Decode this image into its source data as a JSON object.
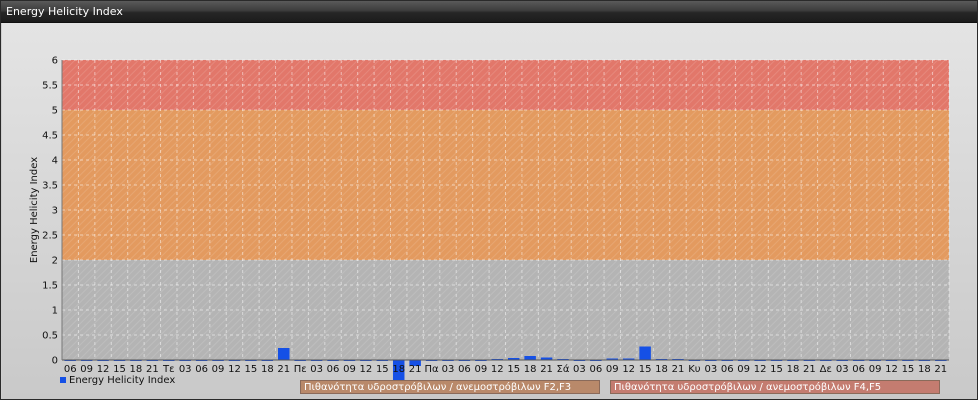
{
  "window": {
    "title": "Energy Helicity Index"
  },
  "chart_data": {
    "type": "bar",
    "title": "",
    "xlabel": "",
    "ylabel": "Energy Helicity Index",
    "ylim": [
      0,
      6
    ],
    "yticks": [
      "0",
      "0.5",
      "1",
      "1.5",
      "2",
      "2.5",
      "3",
      "3.5",
      "4",
      "4.5",
      "5",
      "5.5",
      "6"
    ],
    "grid": true,
    "categories": [
      "06",
      "09",
      "12",
      "15",
      "18",
      "21",
      "Τε",
      "03",
      "06",
      "09",
      "12",
      "15",
      "18",
      "21",
      "Πε",
      "03",
      "06",
      "09",
      "12",
      "15",
      "18",
      "21",
      "Πα",
      "03",
      "06",
      "09",
      "12",
      "15",
      "18",
      "21",
      "Σά",
      "03",
      "06",
      "09",
      "12",
      "15",
      "18",
      "21",
      "Κυ",
      "03",
      "06",
      "09",
      "12",
      "15",
      "18",
      "21",
      "Δε",
      "03",
      "06",
      "09",
      "12",
      "15",
      "18",
      "21"
    ],
    "series": [
      {
        "name": "Energy Helicity Index",
        "color": "#1550e6",
        "values": [
          0.01,
          0.01,
          0.01,
          0.01,
          0.01,
          0.01,
          0.01,
          0.01,
          0.01,
          0.01,
          0.01,
          0.01,
          0.01,
          0.24,
          0.01,
          0.01,
          0.01,
          0.01,
          0.01,
          0.01,
          -0.5,
          -0.12,
          0.01,
          0.01,
          0.01,
          0.01,
          0.02,
          0.04,
          0.08,
          0.05,
          0.02,
          0.01,
          0.01,
          0.03,
          0.03,
          0.27,
          0.02,
          0.02,
          0.01,
          0.01,
          0.01,
          0.01,
          0.01,
          0.01,
          0.01,
          0.01,
          0.01,
          0.01,
          0.01,
          0.01,
          0.01,
          0.01,
          0.01,
          0.01
        ]
      }
    ],
    "bands": [
      {
        "from": 2,
        "to": 5,
        "color": "#e39a5f",
        "label": "Πιθανότητα υδροστρόβιλων / ανεμοστρόβιλων F2,F3"
      },
      {
        "from": 5,
        "to": 6,
        "color": "#e2776a",
        "label": "Πιθανότητα υδροστρόβιλων / ανεμοστρόβιλων F4,F5"
      }
    ],
    "legend_position": "bottom-left"
  }
}
